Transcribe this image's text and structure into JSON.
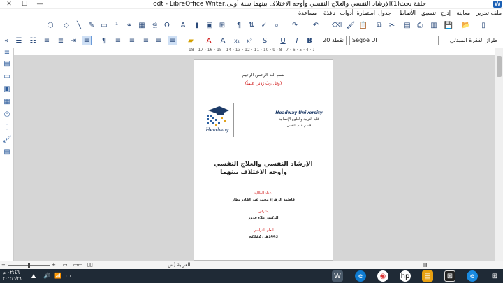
{
  "window": {
    "title": "حلقة بحث(1)الإرشاد النفسي والعلاج النفسي وأوجه الاختلاف بينهما سنة أولى.odt - LibreOffice Writer",
    "minimize_glyph": "—",
    "maximize_glyph": "☐",
    "close_glyph": "✕"
  },
  "menu": [
    "ملف",
    "تحرير",
    "معاينة",
    "إدرج",
    "تنسيق",
    "الأنماط",
    "جدول",
    "استمارة",
    "أدوات",
    "نافذة",
    "مساعدة"
  ],
  "toolbar": {
    "paragraph_style": "طراز الفقرة المبدئي",
    "font_name": "Segoe UI",
    "font_size": "نقطة 20",
    "icons": [
      "new-icon",
      "open-icon",
      "save-icon",
      "export-pdf-icon",
      "print-icon",
      "print-preview-icon",
      "cut-icon",
      "copy-icon",
      "paste-icon",
      "clone-icon",
      "clear-icon",
      "undo-icon",
      "redo-icon",
      "find-icon",
      "spellcheck-icon",
      "formatting-marks-icon",
      "table-icon",
      "image-icon",
      "chart-icon",
      "textbox-icon",
      "page-break-icon",
      "field-icon",
      "special-char-icon",
      "hyperlink-icon",
      "footnote-icon",
      "comment-icon",
      "track-changes-icon",
      "line-icon",
      "shapes-icon"
    ]
  },
  "format": {
    "bold": "B",
    "italic": "I",
    "underline": "U",
    "strike": "S",
    "superscript": "x²",
    "subscript": "x₂",
    "font_color_glyph": "A"
  },
  "ruler": "18 · 17 · 16 · 15 · 14 · 13 · 12 · 11 · 10 · 9 · 8 · 7 · 6 · 5 · 4 · 3 · 2 · 1 · 1 · 2",
  "document": {
    "basmala": "بسم الله الرحمن الرحيم",
    "verse": "(وقل ربّ زدني علماً)",
    "university": "Headway University",
    "faculty": "كلية التربية والعلوم الإنسانية",
    "department": "قسم علم النفس",
    "logo_text": "Headway",
    "title_line1": "الإرشاد النفسي والعلاج النفسي",
    "title_line2": "وأوجه الاختلاف بينهما",
    "prepared_label": "إعداد الطالبة",
    "student_name": "فاطمة الزهراء محمد عبد القادر بطار",
    "supervisor_label": "إشراف",
    "supervisor_name": "الدكتور علاء قدور",
    "year_label": "العام الدراسي",
    "year_value": "1443هـ / 2022م"
  },
  "status": {
    "language": "العربية (س",
    "zoom_minus": "−",
    "zoom_plus": "+"
  },
  "taskbar": {
    "time": "٠٢:٤٦ م",
    "date": "٢٠٢٢/٦/٢٩"
  }
}
